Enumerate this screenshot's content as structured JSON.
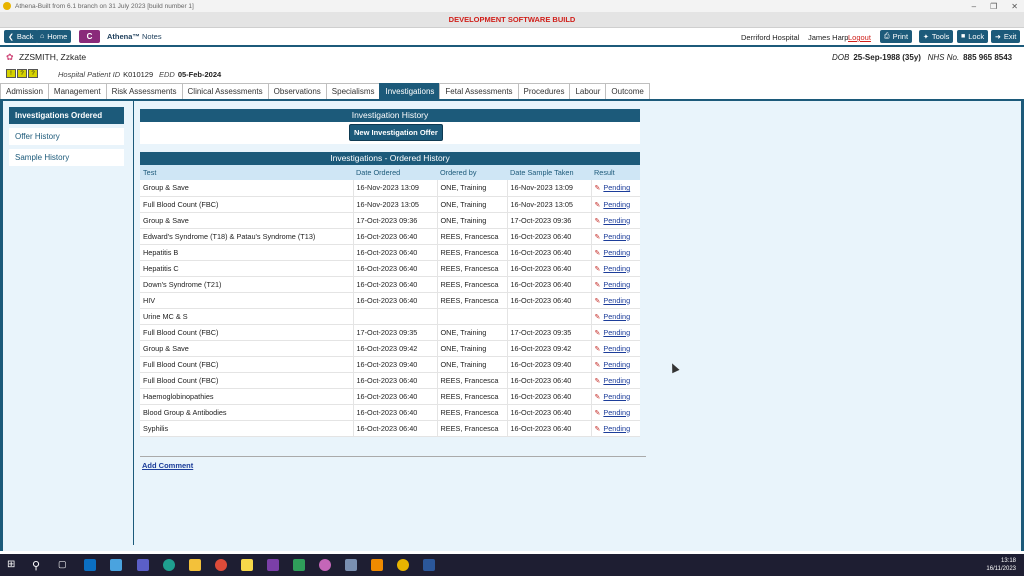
{
  "window": {
    "title": "Athena-Built from 6.1 branch on 31 July 2023 [build number 1]",
    "dev_banner": "DEVELOPMENT SOFTWARE BUILD"
  },
  "toolbar": {
    "back": "Back",
    "home": "Home",
    "c_label": "C",
    "brand": "Athena™",
    "brand_sub": "Notes",
    "hospital": "Derriford Hospital",
    "user": "James Harp",
    "logout": "Logout",
    "print": "Print",
    "tools": "Tools",
    "lock": "Lock",
    "exit": "Exit"
  },
  "patient": {
    "name": "ZZSMITH, Zzkate",
    "dob_label": "DOB",
    "dob": "25-Sep-1988 (35y)",
    "nhs_label": "NHS No.",
    "nhs": "885 965 8543",
    "hpid_label": "Hospital Patient ID",
    "hpid": "K010129",
    "edd_label": "EDD",
    "edd": "05-Feb-2024"
  },
  "tabs": [
    {
      "label": "Admission"
    },
    {
      "label": "Management"
    },
    {
      "label": "Risk Assessments"
    },
    {
      "label": "Clinical Assessments"
    },
    {
      "label": "Observations"
    },
    {
      "label": "Specialisms"
    },
    {
      "label": "Investigations",
      "active": true
    },
    {
      "label": "Fetal Assessments"
    },
    {
      "label": "Procedures"
    },
    {
      "label": "Labour"
    },
    {
      "label": "Outcome"
    }
  ],
  "sidebar": [
    {
      "label": "Investigations Ordered",
      "active": true
    },
    {
      "label": "Offer History"
    },
    {
      "label": "Sample History"
    }
  ],
  "history": {
    "title": "Investigation History",
    "offer_button": "New Investigation Offer"
  },
  "ordered": {
    "title": "Investigations - Ordered History",
    "columns": [
      "Test",
      "Date Ordered",
      "Ordered by",
      "Date Sample Taken",
      "Result"
    ],
    "rows": [
      [
        "Group & Save",
        "16-Nov-2023 13:09",
        "ONE, Training",
        "16-Nov-2023 13:09",
        "Pending"
      ],
      [
        "Full Blood Count (FBC)",
        "16-Nov-2023 13:05",
        "ONE, Training",
        "16-Nov-2023 13:05",
        "Pending"
      ],
      [
        "Group & Save",
        "17-Oct-2023 09:36",
        "ONE, Training",
        "17-Oct-2023 09:36",
        "Pending"
      ],
      [
        "Edward's Syndrome (T18) & Patau's Syndrome (T13)",
        "16-Oct-2023 06:40",
        "REES, Francesca",
        "16-Oct-2023 06:40",
        "Pending"
      ],
      [
        "Hepatitis B",
        "16-Oct-2023 06:40",
        "REES, Francesca",
        "16-Oct-2023 06:40",
        "Pending"
      ],
      [
        "Hepatitis C",
        "16-Oct-2023 06:40",
        "REES, Francesca",
        "16-Oct-2023 06:40",
        "Pending"
      ],
      [
        "Down's Syndrome (T21)",
        "16-Oct-2023 06:40",
        "REES, Francesca",
        "16-Oct-2023 06:40",
        "Pending"
      ],
      [
        "HIV",
        "16-Oct-2023 06:40",
        "REES, Francesca",
        "16-Oct-2023 06:40",
        "Pending"
      ],
      [
        "Urine MC & S",
        "",
        "",
        "",
        "Pending"
      ],
      [
        "Full Blood Count (FBC)",
        "17-Oct-2023 09:35",
        "ONE, Training",
        "17-Oct-2023 09:35",
        "Pending"
      ],
      [
        "Group & Save",
        "16-Oct-2023 09:42",
        "ONE, Training",
        "16-Oct-2023 09:42",
        "Pending"
      ],
      [
        "Full Blood Count (FBC)",
        "16-Oct-2023 09:40",
        "ONE, Training",
        "16-Oct-2023 09:40",
        "Pending"
      ],
      [
        "Full Blood Count (FBC)",
        "16-Oct-2023 06:40",
        "REES, Francesca",
        "16-Oct-2023 06:40",
        "Pending"
      ],
      [
        "Haemoglobinopathies",
        "16-Oct-2023 06:40",
        "REES, Francesca",
        "16-Oct-2023 06:40",
        "Pending"
      ],
      [
        "Blood Group & Antibodies",
        "16-Oct-2023 06:40",
        "REES, Francesca",
        "16-Oct-2023 06:40",
        "Pending"
      ],
      [
        "Syphilis",
        "16-Oct-2023 06:40",
        "REES, Francesca",
        "16-Oct-2023 06:40",
        "Pending"
      ]
    ]
  },
  "add_comment": "Add Comment",
  "clock": {
    "time": "13:18",
    "date": "16/11/2023"
  },
  "colors": {
    "primary": "#1c5a7a",
    "dev_banner": "#d0201b",
    "content_bg": "#e9f4fb"
  }
}
